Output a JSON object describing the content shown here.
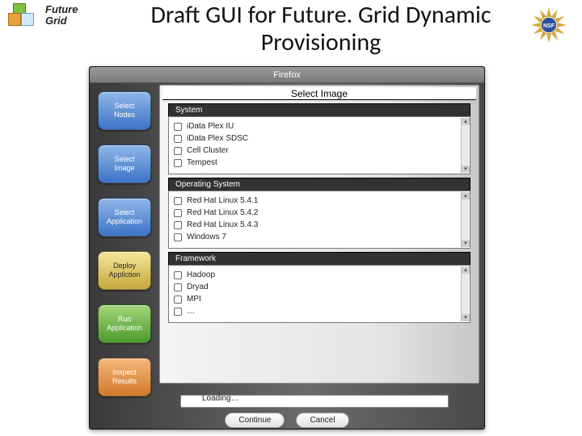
{
  "header": {
    "logo_line1": "Future",
    "logo_line2": "Grid",
    "title": "Draft GUI for Future. Grid Dynamic Provisioning"
  },
  "window": {
    "title": "Firefox",
    "content_title": "Select Image"
  },
  "sidebar": {
    "items": [
      {
        "label": "Select\nNodes",
        "style": "blue"
      },
      {
        "label": "Select\nImage",
        "style": "blue"
      },
      {
        "label": "Select\nApplication",
        "style": "blue"
      },
      {
        "label": "Deploy\nAppliction",
        "style": "yellow"
      },
      {
        "label": "Run\nApplication",
        "style": "green"
      },
      {
        "label": "Inspect\nResults",
        "style": "orange"
      }
    ]
  },
  "sections": [
    {
      "title": "System",
      "options": [
        "iData Plex IU",
        "iData Plex SDSC",
        "Cell Cluster",
        "Tempest"
      ]
    },
    {
      "title": "Operating System",
      "options": [
        "Red Hat Linux 5.4.1",
        "Red Hat Linux 5.4.2",
        "Red Hat Linux 5.4.3",
        "Windows 7"
      ]
    },
    {
      "title": "Framework",
      "options": [
        "Hadoop",
        "Dryad",
        "MPI",
        "…"
      ]
    }
  ],
  "progress": {
    "label": "Loading…"
  },
  "actions": {
    "continue": "Continue",
    "cancel": "Cancel"
  }
}
